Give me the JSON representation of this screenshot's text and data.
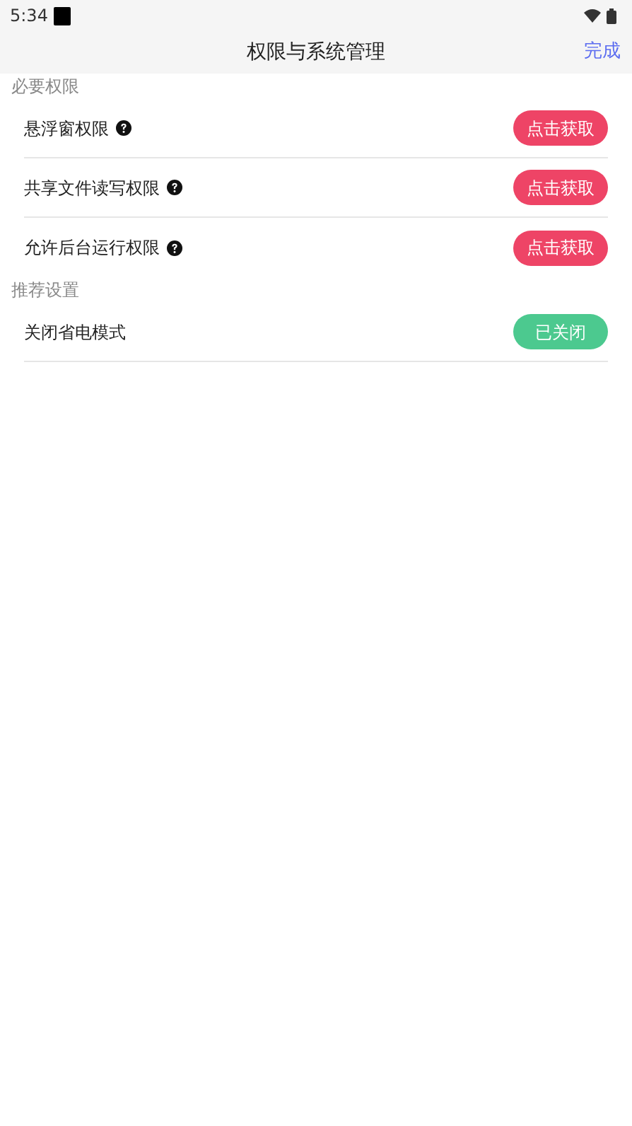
{
  "status_bar": {
    "time": "5:34"
  },
  "header": {
    "title": "权限与系统管理",
    "done": "完成"
  },
  "sections": [
    {
      "title": "必要权限",
      "items": [
        {
          "label": "悬浮窗权限",
          "help": true,
          "button": "点击获取",
          "granted": false
        },
        {
          "label": "共享文件读写权限",
          "help": true,
          "button": "点击获取",
          "granted": false
        },
        {
          "label": "允许后台运行权限",
          "help": true,
          "button": "点击获取",
          "granted": false
        }
      ]
    },
    {
      "title": "推荐设置",
      "items": [
        {
          "label": "关闭省电模式",
          "help": false,
          "button": "已关闭",
          "granted": true
        }
      ]
    }
  ]
}
